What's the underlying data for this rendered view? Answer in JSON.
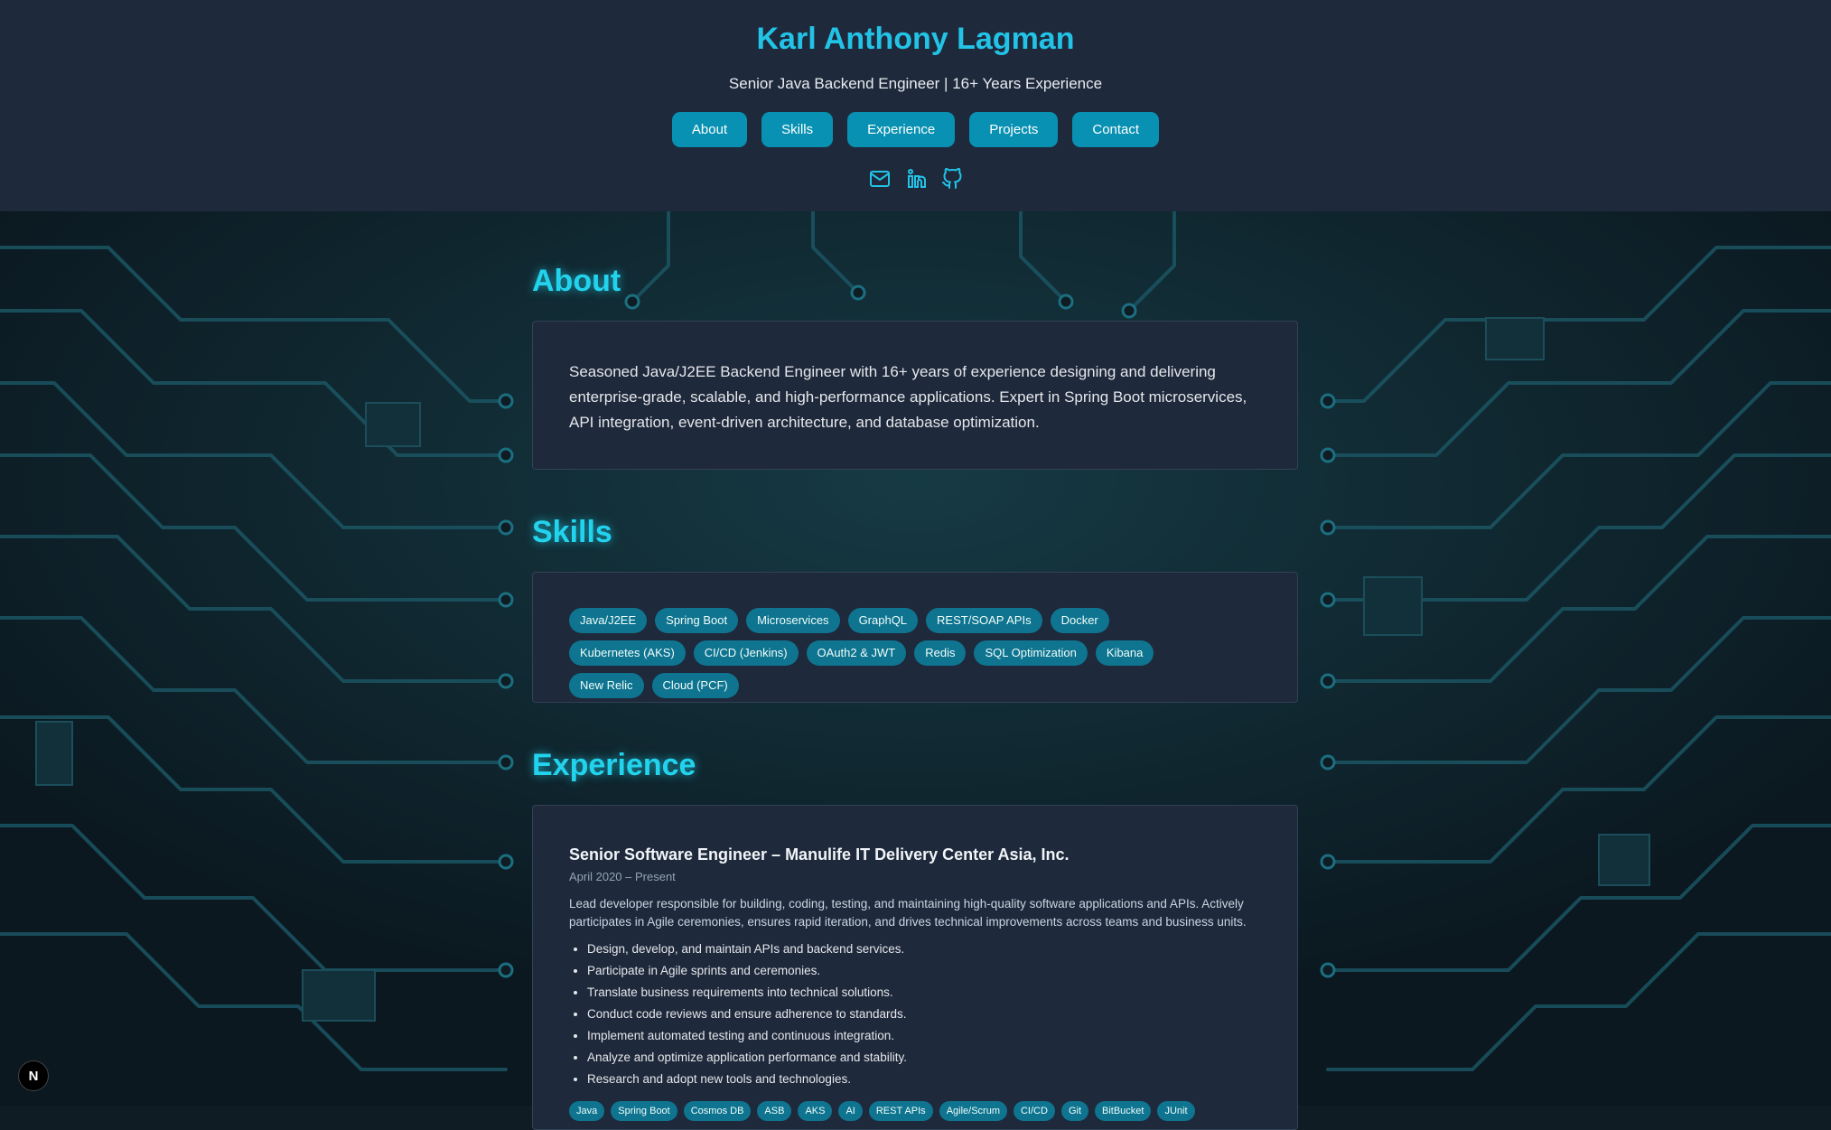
{
  "header": {
    "name": "Karl Anthony Lagman",
    "subtitle": "Senior Java Backend Engineer | 16+ Years Experience",
    "nav": [
      "About",
      "Skills",
      "Experience",
      "Projects",
      "Contact"
    ],
    "social_icons": [
      "mail-icon",
      "linkedin-icon",
      "github-icon"
    ]
  },
  "about": {
    "title": "About",
    "text": "Seasoned Java/J2EE Backend Engineer with 16+ years of experience designing and delivering enterprise-grade, scalable, and high-performance applications. Expert in Spring Boot microservices, API integration, event-driven architecture, and database optimization."
  },
  "skills": {
    "title": "Skills",
    "items": [
      "Java/J2EE",
      "Spring Boot",
      "Microservices",
      "GraphQL",
      "REST/SOAP APIs",
      "Docker",
      "Kubernetes (AKS)",
      "CI/CD (Jenkins)",
      "OAuth2 & JWT",
      "Redis",
      "SQL Optimization",
      "Kibana",
      "New Relic",
      "Cloud (PCF)"
    ]
  },
  "experience": {
    "title": "Experience",
    "jobs": [
      {
        "title": "Senior Software Engineer – Manulife IT Delivery Center Asia, Inc.",
        "date": "April 2020 – Present",
        "description": "Lead developer responsible for building, coding, testing, and maintaining high-quality software applications and APIs. Actively participates in Agile ceremonies, ensures rapid iteration, and drives technical improvements across teams and business units.",
        "bullets": [
          "Design, develop, and maintain APIs and backend services.",
          "Participate in Agile sprints and ceremonies.",
          "Translate business requirements into technical solutions.",
          "Conduct code reviews and ensure adherence to standards.",
          "Implement automated testing and continuous integration.",
          "Analyze and optimize application performance and stability.",
          "Research and adopt new tools and technologies."
        ],
        "tags": [
          "Java",
          "Spring Boot",
          "Cosmos DB",
          "ASB",
          "AKS",
          "AI",
          "REST APIs",
          "Agile/Scrum",
          "CI/CD",
          "Git",
          "BitBucket",
          "JUnit"
        ]
      }
    ]
  },
  "badge": "N",
  "colors": {
    "accent": "#22d3ee",
    "header_bg": "#1e293b",
    "button": "#0891b2",
    "tag": "#0e7490",
    "card": "#1e293b",
    "circuit": "#134e5a"
  }
}
